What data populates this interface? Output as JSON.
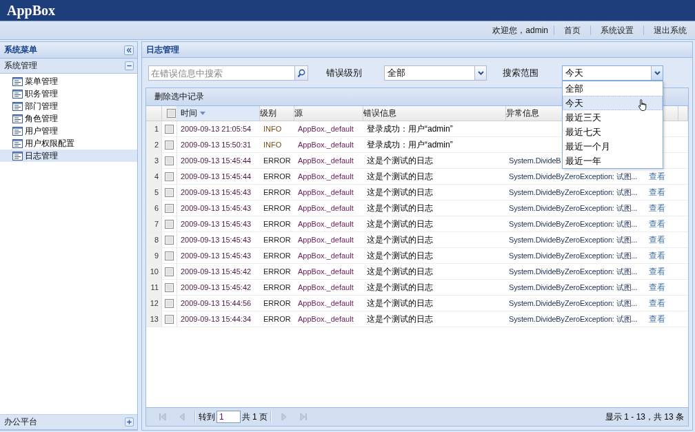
{
  "app": {
    "title": "AppBox"
  },
  "topbar": {
    "welcome": "欢迎您，admin",
    "links": [
      "首页",
      "系统设置",
      "退出系统"
    ]
  },
  "sidebar": {
    "title": "系统菜单",
    "sections": [
      {
        "title": "系统管理",
        "expanded": true,
        "items": [
          {
            "label": "菜单管理",
            "selected": false
          },
          {
            "label": "职务管理",
            "selected": false
          },
          {
            "label": "部门管理",
            "selected": false
          },
          {
            "label": "角色管理",
            "selected": false
          },
          {
            "label": "用户管理",
            "selected": false
          },
          {
            "label": "用户权限配置",
            "selected": false
          },
          {
            "label": "日志管理",
            "selected": true
          }
        ]
      },
      {
        "title": "办公平台",
        "expanded": false
      }
    ]
  },
  "main": {
    "title": "日志管理",
    "search": {
      "placeholder": "在错误信息中搜索"
    },
    "filters": [
      {
        "label": "错误级别",
        "value": "全部",
        "expanded": false
      },
      {
        "label": "搜索范围",
        "value": "今天",
        "expanded": true,
        "options": [
          {
            "label": "全部",
            "selected": false
          },
          {
            "label": "今天",
            "selected": true
          },
          {
            "label": "最近三天",
            "selected": false
          },
          {
            "label": "最近七天",
            "selected": false
          },
          {
            "label": "最近一个月",
            "selected": false
          },
          {
            "label": "最近一年",
            "selected": false
          }
        ]
      }
    ],
    "grid": {
      "toolbar": [
        "删除选中记录"
      ],
      "select_all": {
        "checked": false
      },
      "columns": [
        {
          "label": "时间",
          "sorted": true
        },
        {
          "label": "级别",
          "sorted": false
        },
        {
          "label": "源",
          "sorted": false
        },
        {
          "label": "错误信息",
          "sorted": false
        },
        {
          "label": "异常信息",
          "sorted": false
        }
      ],
      "rows": [
        {
          "number": "1",
          "checked": false,
          "time": "2009-09-13 21:05:54",
          "severity": "INFO",
          "source": "AppBox._default",
          "message": "登录成功：用户“admin”"
        },
        {
          "number": "2",
          "checked": false,
          "time": "2009-09-13 15:50:31",
          "severity": "INFO",
          "source": "AppBox._default",
          "message": "登录成功：用户“admin”"
        },
        {
          "number": "3",
          "checked": false,
          "time": "2009-09-13 15:45:44",
          "severity": "ERROR",
          "source": "AppBox._default",
          "message": "这是个测试的日志",
          "exception": "System.DivideB"
        },
        {
          "number": "4",
          "checked": false,
          "time": "2009-09-13 15:45:44",
          "severity": "ERROR",
          "source": "AppBox._default",
          "message": "这是个测试的日志",
          "exception": "System.DivideByZeroException: 试图...",
          "action": "查看"
        },
        {
          "number": "5",
          "checked": false,
          "time": "2009-09-13 15:45:43",
          "severity": "ERROR",
          "source": "AppBox._default",
          "message": "这是个测试的日志",
          "exception": "System.DivideByZeroException: 试图...",
          "action": "查看"
        },
        {
          "number": "6",
          "checked": false,
          "time": "2009-09-13 15:45:43",
          "severity": "ERROR",
          "source": "AppBox._default",
          "message": "这是个测试的日志",
          "exception": "System.DivideByZeroException: 试图...",
          "action": "查看"
        },
        {
          "number": "7",
          "checked": false,
          "time": "2009-09-13 15:45:43",
          "severity": "ERROR",
          "source": "AppBox._default",
          "message": "这是个测试的日志",
          "exception": "System.DivideByZeroException: 试图...",
          "action": "查看"
        },
        {
          "number": "8",
          "checked": false,
          "time": "2009-09-13 15:45:43",
          "severity": "ERROR",
          "source": "AppBox._default",
          "message": "这是个测试的日志",
          "exception": "System.DivideByZeroException: 试图...",
          "action": "查看"
        },
        {
          "number": "9",
          "checked": false,
          "time": "2009-09-13 15:45:43",
          "severity": "ERROR",
          "source": "AppBox._default",
          "message": "这是个测试的日志",
          "exception": "System.DivideByZeroException: 试图...",
          "action": "查看"
        },
        {
          "number": "10",
          "checked": false,
          "time": "2009-09-13 15:45:42",
          "severity": "ERROR",
          "source": "AppBox._default",
          "message": "这是个测试的日志",
          "exception": "System.DivideByZeroException: 试图...",
          "action": "查看"
        },
        {
          "number": "11",
          "checked": false,
          "time": "2009-09-13 15:45:42",
          "severity": "ERROR",
          "source": "AppBox._default",
          "message": "这是个测试的日志",
          "exception": "System.DivideByZeroException: 试图...",
          "action": "查看"
        },
        {
          "number": "12",
          "checked": false,
          "time": "2009-09-13 15:44:56",
          "severity": "ERROR",
          "source": "AppBox._default",
          "message": "这是个测试的日志",
          "exception": "System.DivideByZeroException: 试图...",
          "action": "查看"
        },
        {
          "number": "13",
          "checked": false,
          "time": "2009-09-13 15:44:34",
          "severity": "ERROR",
          "source": "AppBox._default",
          "message": "这是个测试的日志",
          "exception": "System.DivideByZeroException: 试图...",
          "action": "查看"
        }
      ],
      "pager": {
        "goto_label": "转到",
        "page": "1",
        "total_label": "共",
        "total_pages": "1",
        "pages_suffix": "页",
        "summary": "显示 1 - 13，共 13 条"
      }
    }
  }
}
